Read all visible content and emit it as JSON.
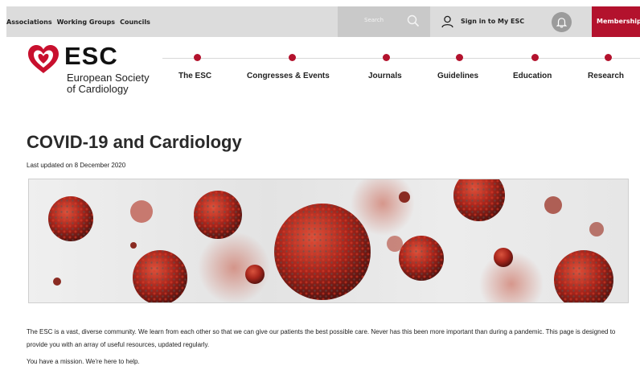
{
  "topbar": {
    "links": [
      "Associations",
      "Working Groups",
      "Councils"
    ],
    "search_placeholder": "Search",
    "signin_label": "Sign in to My ESC",
    "membership_label": "Membership"
  },
  "logo": {
    "acronym": "ESC",
    "name_line1": "European Society",
    "name_line2": "of Cardiology"
  },
  "nav": {
    "items": [
      "The ESC",
      "Congresses & Events",
      "Journals",
      "Guidelines",
      "Education",
      "Research"
    ]
  },
  "page": {
    "title": "COVID-19 and Cardiology",
    "updated": "Last updated on 8 December 2020",
    "body": "The ESC is a vast, diverse community. We learn from each other so that we can give our patients the best possible care. Never has this been more important than during a pandemic. This page is designed to provide you with an array of useful resources, updated regularly.",
    "tagline": "You have a mission. We're here to help."
  },
  "colors": {
    "brand_red": "#b3122d",
    "topbar_grey": "#dcdcdc"
  },
  "icons": [
    "search-icon",
    "user-icon",
    "bell-icon",
    "esc-heart-logo-icon"
  ]
}
